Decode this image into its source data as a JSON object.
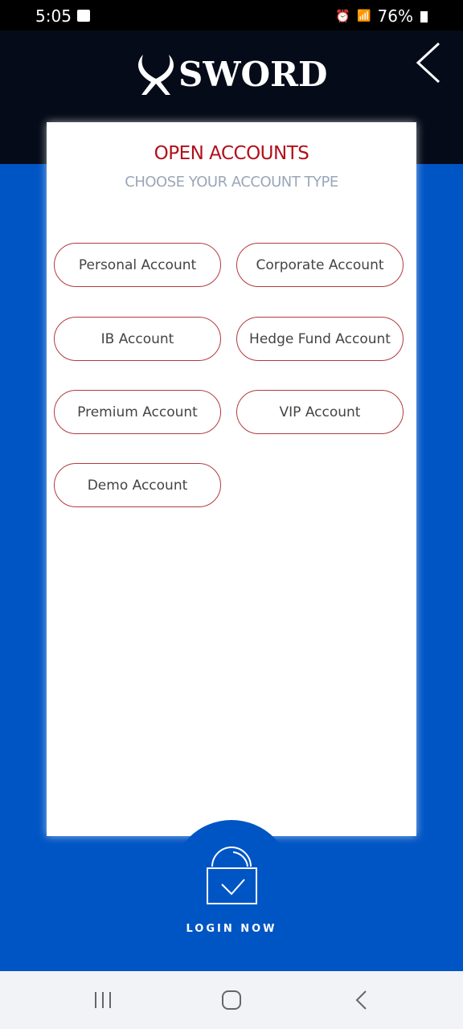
{
  "status_bar": {
    "time": "5:05",
    "battery": "76%"
  },
  "header": {
    "logo": "SWORD",
    "back_icon": "chevron-left-icon"
  },
  "card": {
    "title": "OPEN ACCOUNTS",
    "subtitle": "CHOOSE YOUR ACCOUNT TYPE",
    "accounts": [
      "Personal Account",
      "Corporate Account",
      "IB Account",
      "Hedge Fund Account",
      "Premium Account",
      "VIP Account",
      "Demo Account"
    ]
  },
  "login": {
    "label": "LOGIN NOW",
    "icon": "lock-check-icon"
  },
  "colors": {
    "header": "#050b19",
    "background": "#0055c4",
    "title": "#b0111c",
    "button_border": "#b33a3f"
  }
}
